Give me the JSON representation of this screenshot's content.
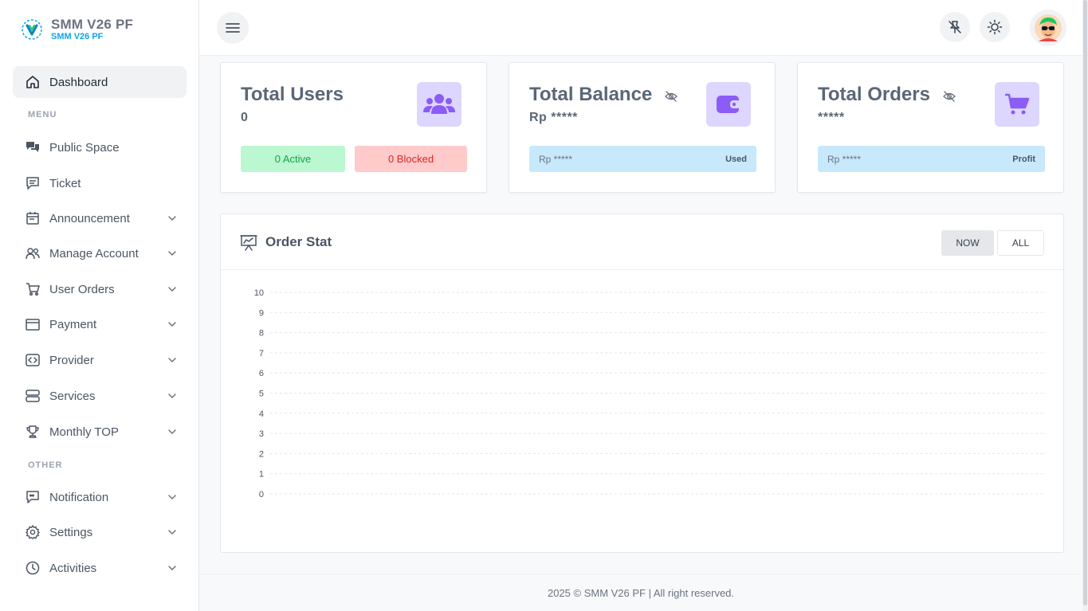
{
  "brand": {
    "title": "SMM V26 PF",
    "subtitle": "SMM V26 PF"
  },
  "sidebar": {
    "dashboard": "Dashboard",
    "section_menu": "MENU",
    "section_other": "OTHER",
    "items": [
      {
        "label": "Public Space",
        "icon": "chat-bubbles-icon",
        "dropdown": false
      },
      {
        "label": "Ticket",
        "icon": "ticket-message-icon",
        "dropdown": false
      },
      {
        "label": "Announcement",
        "icon": "calendar-icon",
        "dropdown": true
      },
      {
        "label": "Manage Account",
        "icon": "users-icon",
        "dropdown": true
      },
      {
        "label": "User Orders",
        "icon": "cart-icon",
        "dropdown": true
      },
      {
        "label": "Payment",
        "icon": "wallet-icon",
        "dropdown": true
      },
      {
        "label": "Provider",
        "icon": "code-icon",
        "dropdown": true
      },
      {
        "label": "Services",
        "icon": "server-icon",
        "dropdown": true
      },
      {
        "label": "Monthly TOP",
        "icon": "trophy-icon",
        "dropdown": true
      }
    ],
    "other_items": [
      {
        "label": "Notification",
        "icon": "notification-icon",
        "dropdown": true
      },
      {
        "label": "Settings",
        "icon": "gear-icon",
        "dropdown": true
      },
      {
        "label": "Activities",
        "icon": "clock-icon",
        "dropdown": true
      }
    ]
  },
  "stats": {
    "users": {
      "title": "Total Users",
      "value": "0",
      "active": "0 Active",
      "blocked": "0 Blocked"
    },
    "balance": {
      "title": "Total Balance",
      "value": "Rp *****",
      "bar_value": "Rp *****",
      "bar_tag": "Used"
    },
    "orders": {
      "title": "Total Orders",
      "value": "*****",
      "bar_value": "Rp *****",
      "bar_tag": "Profit"
    }
  },
  "order_stat": {
    "title": "Order Stat",
    "btn_now": "NOW",
    "btn_all": "ALL"
  },
  "chart_data": {
    "type": "line",
    "title": "Order Stat",
    "x": [],
    "series": [],
    "ylim": [
      0,
      10
    ],
    "yticks": [
      "10",
      "9",
      "8",
      "7",
      "6",
      "5",
      "4",
      "3",
      "2",
      "1",
      "0"
    ],
    "grid": true
  },
  "footer": {
    "text": "2025 © SMM V26 PF | All right reserved."
  },
  "colors": {
    "accent": "#8b5cf6",
    "icon_bg": "#ddd6fe",
    "brand_sub": "#0ea5e9",
    "info_bar": "#c7e9fb"
  }
}
